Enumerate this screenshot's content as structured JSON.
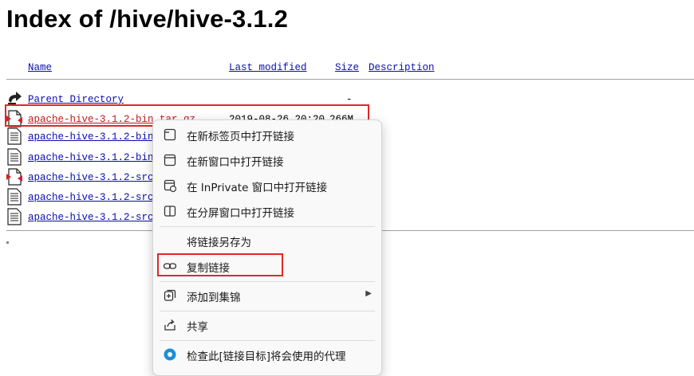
{
  "page": {
    "title": "Index of /hive/hive-3.1.2",
    "columns": {
      "name": "Name",
      "last_modified": "Last modified",
      "size": "Size",
      "description": "Description"
    },
    "rows": [
      {
        "icon": "back-icon",
        "name": "Parent Directory",
        "date": "",
        "size": "-"
      },
      {
        "icon": "archive-file-icon",
        "name": "apache-hive-3.1.2-bin.tar.gz",
        "date": "2019-08-26 20:20",
        "size": "266M"
      },
      {
        "icon": "text-file-icon",
        "name": "apache-hive-3.1.2-bin.t",
        "date": "",
        "size": ""
      },
      {
        "icon": "text-file-icon",
        "name": "apache-hive-3.1.2-bin.t",
        "date": "",
        "size": ""
      },
      {
        "icon": "archive-file-icon",
        "name": "apache-hive-3.1.2-src.t",
        "date": "",
        "size": ""
      },
      {
        "icon": "text-file-icon",
        "name": "apache-hive-3.1.2-src.t",
        "date": "",
        "size": ""
      },
      {
        "icon": "text-file-icon",
        "name": "apache-hive-3.1.2-src.t",
        "date": "",
        "size": ""
      }
    ]
  },
  "context_menu": {
    "items": [
      {
        "icon": "new-tab-icon",
        "label": "在新标签页中打开链接"
      },
      {
        "icon": "new-window-icon",
        "label": "在新窗口中打开链接"
      },
      {
        "icon": "inprivate-window-icon",
        "label": "在 InPrivate 窗口中打开链接"
      },
      {
        "icon": "split-screen-icon",
        "label": "在分屏窗口中打开链接"
      },
      {
        "icon": "",
        "label": "将链接另存为"
      },
      {
        "icon": "link-icon",
        "label": "复制链接"
      },
      {
        "icon": "collections-icon",
        "label": "添加到集锦"
      },
      {
        "icon": "share-icon",
        "label": "共享"
      },
      {
        "icon": "inspect-proxy-icon",
        "label": "检查此[链接目标]将会使用的代理"
      }
    ]
  },
  "colors": {
    "link": "#0b0bb3",
    "highlight": "#e02828",
    "menu_bg": "#f9f9f9"
  }
}
